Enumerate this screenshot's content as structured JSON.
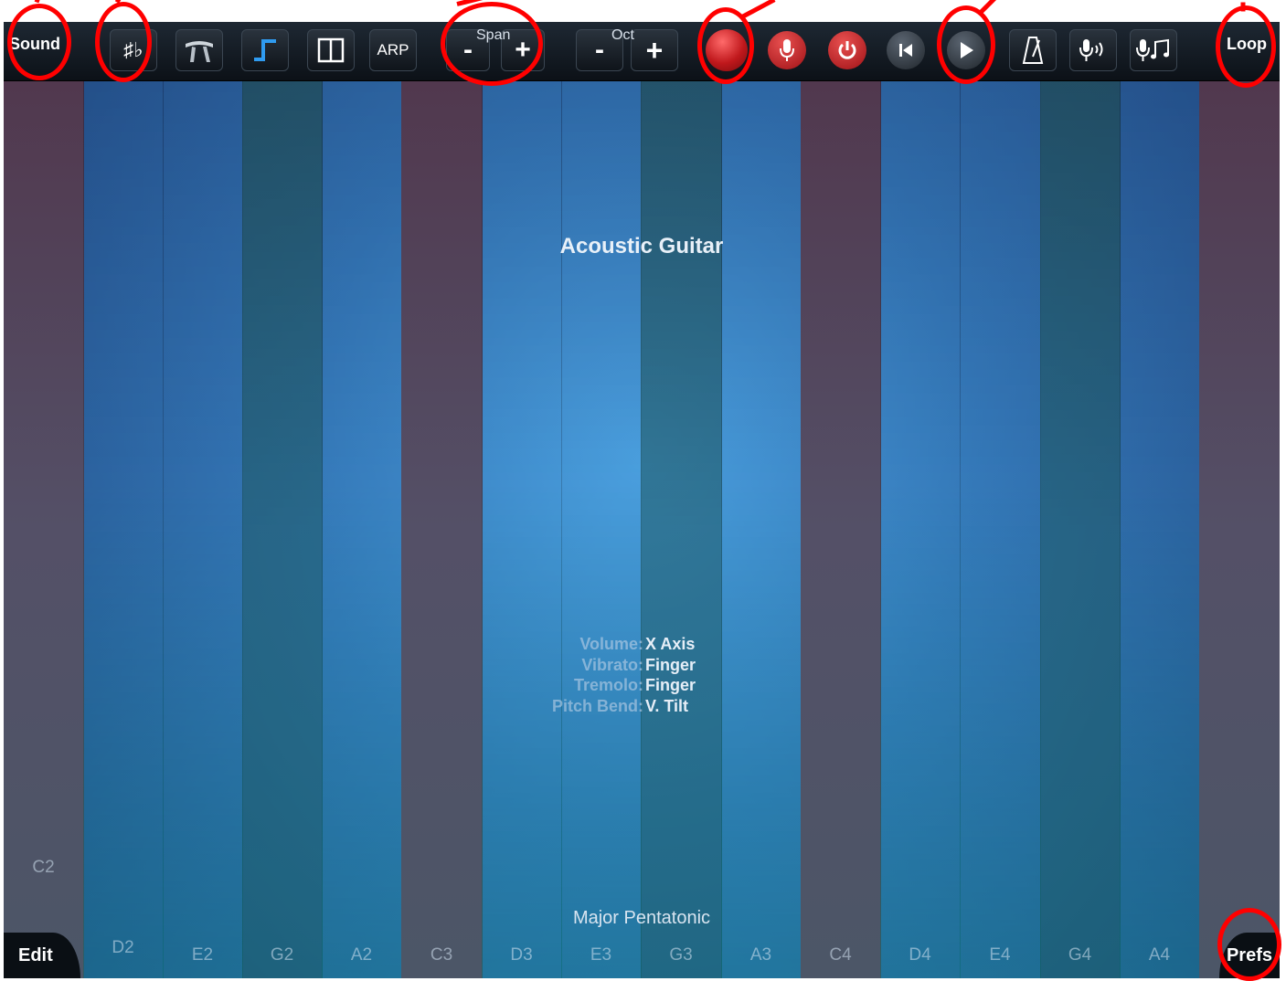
{
  "app": {
    "instrument_title": "Acoustic Guitar",
    "scale_name": "Major Pentatonic"
  },
  "toolbar": {
    "sound_label": "Sound",
    "sharp_flat_label": "♯♭",
    "arp_label": "ARP",
    "span_label": "Span",
    "span_minus": "-",
    "span_plus": "+",
    "oct_label": "Oct",
    "oct_minus": "-",
    "oct_plus": "+",
    "loop_label": "Loop"
  },
  "params": [
    {
      "key": "Volume:",
      "value": "X Axis"
    },
    {
      "key": "Vibrato:",
      "value": "Finger"
    },
    {
      "key": "Tremolo:",
      "value": "Finger"
    },
    {
      "key": "Pitch Bend:",
      "value": "V. Tilt"
    }
  ],
  "notes": [
    "C2",
    "D2",
    "E2",
    "G2",
    "A2",
    "C3",
    "D3",
    "E3",
    "G3",
    "A3",
    "C4",
    "D4",
    "E4",
    "G4",
    "A4",
    ""
  ],
  "bottom": {
    "edit_label": "Edit",
    "prefs_label": "Prefs"
  },
  "colors": {
    "record_red": "#c0181c",
    "annotation_red": "#ff0000",
    "toolbar_bg": "#0c1117"
  }
}
